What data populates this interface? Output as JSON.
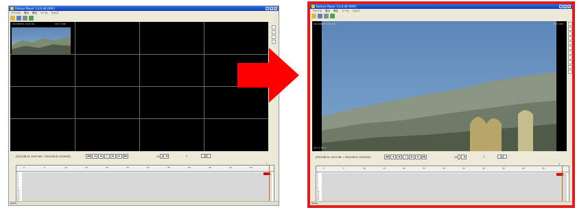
{
  "window": {
    "title": "Darkye Player 1.0.0.44 (RHF)",
    "menu": [
      "ファイル",
      "表示",
      "再生",
      "ツール",
      "ヘルプ"
    ]
  },
  "toolbar": {
    "icons": [
      "open-icon",
      "save-icon",
      "print-icon",
      "export-icon"
    ]
  },
  "left_window": {
    "channel_label": "2013/08/31 13:07:06",
    "channel_id": "CH1 / 1/80"
  },
  "right_window": {
    "video_timestamp": "2013/08/31 13:07:06",
    "video_channel": "CH1 1/80",
    "video_footer": "CH 1 [ 1/01 ]"
  },
  "controls": {
    "date_range": "[2013.08.31 13:07:06 ～ 2013.08.31 13:09:25]",
    "buttons": [
      "◀◀",
      "◀",
      "◀|",
      "||",
      "|▶",
      "▶",
      "▶▶"
    ],
    "speed_label": "1X",
    "page_value": "1",
    "set_label": "設定"
  },
  "timeline": {
    "marker": "3",
    "ticks": [
      "0",
      "5",
      "10",
      "15",
      "20",
      "25",
      "30",
      "35",
      "40",
      "45",
      "50",
      "55"
    ],
    "tracks": [
      "1",
      "2",
      "3",
      "4",
      "5",
      "6",
      "7",
      "8",
      "9",
      "10",
      "11",
      "12",
      "13",
      "14",
      "15",
      "16"
    ]
  },
  "status": {
    "text": "Ready"
  },
  "colors": {
    "title_bar": "#1f5ad2",
    "arrow": "#ff0000",
    "highlight_border": "#e21b1b",
    "event_mark": "#c61010",
    "cursor": "#d06a00"
  }
}
